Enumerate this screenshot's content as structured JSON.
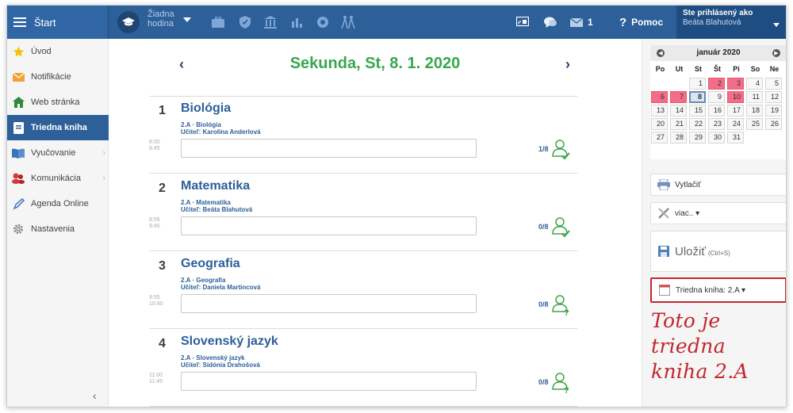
{
  "topbar": {
    "start_label": "Štart",
    "hodina_line1": "Žiadna",
    "hodina_line2": "hodina",
    "screen_icon": "screen-share-icon",
    "chat_icon": "chat-icon",
    "mail_count": "1",
    "help_label": "Pomoc",
    "user_title": "Ste prihlásený ako",
    "user_name": "Beáta Blahutová",
    "accent": "#2d5f99"
  },
  "sidebar": {
    "items": [
      {
        "label": "Úvod",
        "icon": "star-icon"
      },
      {
        "label": "Notifikácie",
        "icon": "mail-icon"
      },
      {
        "label": "Web stránka",
        "icon": "home-icon"
      },
      {
        "label": "Triedna kniha",
        "icon": "book-icon"
      },
      {
        "label": "Vyučovanie",
        "icon": "open-book-icon"
      },
      {
        "label": "Komunikácia",
        "icon": "people-icon"
      },
      {
        "label": "Agenda Online",
        "icon": "pen-icon"
      },
      {
        "label": "Nastavenia",
        "icon": "gear-icon"
      }
    ],
    "active": "Triedna kniha"
  },
  "main": {
    "date_title": "Sekunda, St, 8. 1. 2020",
    "lessons": [
      {
        "num": "1",
        "name": "Biológia",
        "sub": "2.A · Biológia",
        "teacher": "Učiteľ:  Karolína Anderlová",
        "start": "8:00",
        "end": "8:45",
        "count": "1/8"
      },
      {
        "num": "2",
        "name": "Matematika",
        "sub": "2.A · Matematika",
        "teacher": "Učiteľ:  Beáta Blahutová",
        "start": "8:55",
        "end": "9:40",
        "count": "0/8"
      },
      {
        "num": "3",
        "name": "Geografia",
        "sub": "2.A · Geografia",
        "teacher": "Učiteľ:  Daniela Martincová",
        "start": "9:55",
        "end": "10:40",
        "count": "0/8"
      },
      {
        "num": "4",
        "name": "Slovenský jazyk",
        "sub": "2.A · Slovenský jazyk",
        "teacher": "Učiteľ:  Sidónia Drahošová",
        "start": "11:00",
        "end": "11:45",
        "count": "0/8"
      }
    ]
  },
  "calendar": {
    "month": "január 2020",
    "dow": [
      "Po",
      "Ut",
      "St",
      "Št",
      "Pi",
      "So",
      "Ne"
    ],
    "weeks": [
      [
        "",
        "",
        "1",
        "2",
        "3",
        "4",
        "5"
      ],
      [
        "6",
        "7",
        "8",
        "9",
        "10",
        "11",
        "12"
      ],
      [
        "13",
        "14",
        "15",
        "16",
        "17",
        "18",
        "19"
      ],
      [
        "20",
        "21",
        "22",
        "23",
        "24",
        "25",
        "26"
      ],
      [
        "27",
        "28",
        "29",
        "30",
        "31",
        "",
        ""
      ]
    ],
    "highlighted": [
      "2",
      "3",
      "6",
      "7",
      "10"
    ],
    "today": "8",
    "highlight_color": "#f46d86"
  },
  "actions": {
    "print_label": "Vytlačiť",
    "more_label": "viac.. ▾",
    "save_label": "Uložiť",
    "save_shortcut": "(Ctrl+S)",
    "classbook_label": "Triedna kniha: 2.A ▾"
  },
  "annotation": {
    "line1": "Toto je triedna",
    "line2": "kniha 2.A",
    "color": "#c1272d"
  }
}
